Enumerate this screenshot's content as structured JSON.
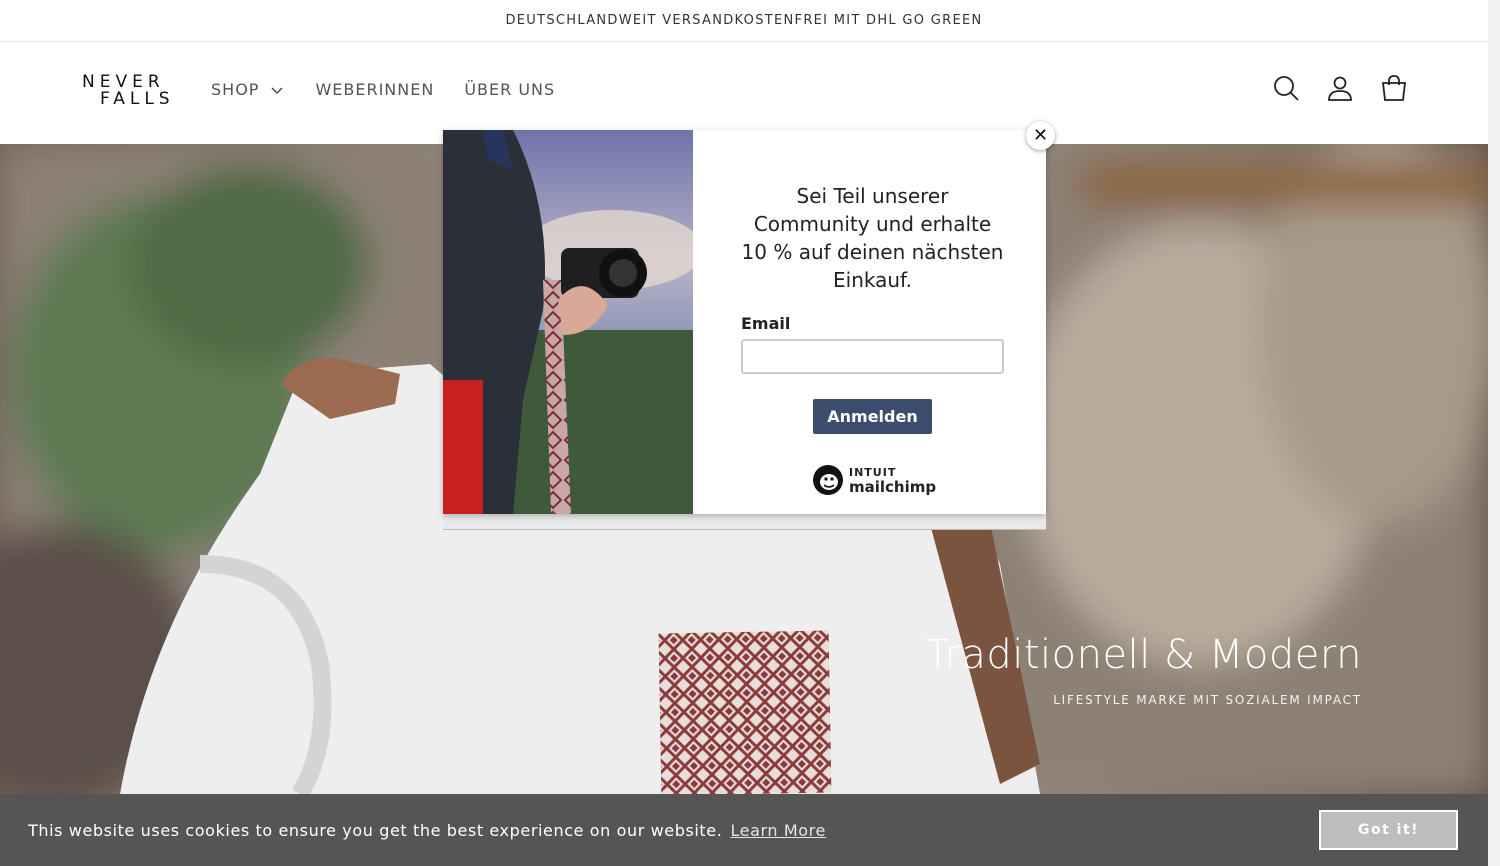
{
  "announcement": "DEUTSCHLANDWEIT VERSANDKOSTENFREI MIT DHL GO GREEN",
  "logo": {
    "line1": "NEVER",
    "line2": "FALLS"
  },
  "nav": {
    "items": [
      {
        "label": "SHOP",
        "has_dropdown": true
      },
      {
        "label": "WEBERINNEN"
      },
      {
        "label": "ÜBER UNS"
      }
    ]
  },
  "header_icons": [
    "search-icon",
    "account-icon",
    "cart-icon"
  ],
  "hero": {
    "title": "Traditionell & Modern",
    "subtitle": "LIFESTYLE MARKE MIT SOZIALEM IMPACT"
  },
  "popup": {
    "message": "Sei Teil unserer Community und erhalte 10 % auf deinen nächsten Einkauf.",
    "email_label": "Email",
    "email_value": "",
    "submit_label": "Anmelden",
    "brand_line1": "INTUIT",
    "brand_line2": "mailchimp",
    "close_label": "✕",
    "button_color": "#3c4c6c"
  },
  "cookie": {
    "message": "This website uses cookies to ensure you get the best experience on our website.",
    "link_label": "Learn More",
    "button_label": "Got it!"
  }
}
